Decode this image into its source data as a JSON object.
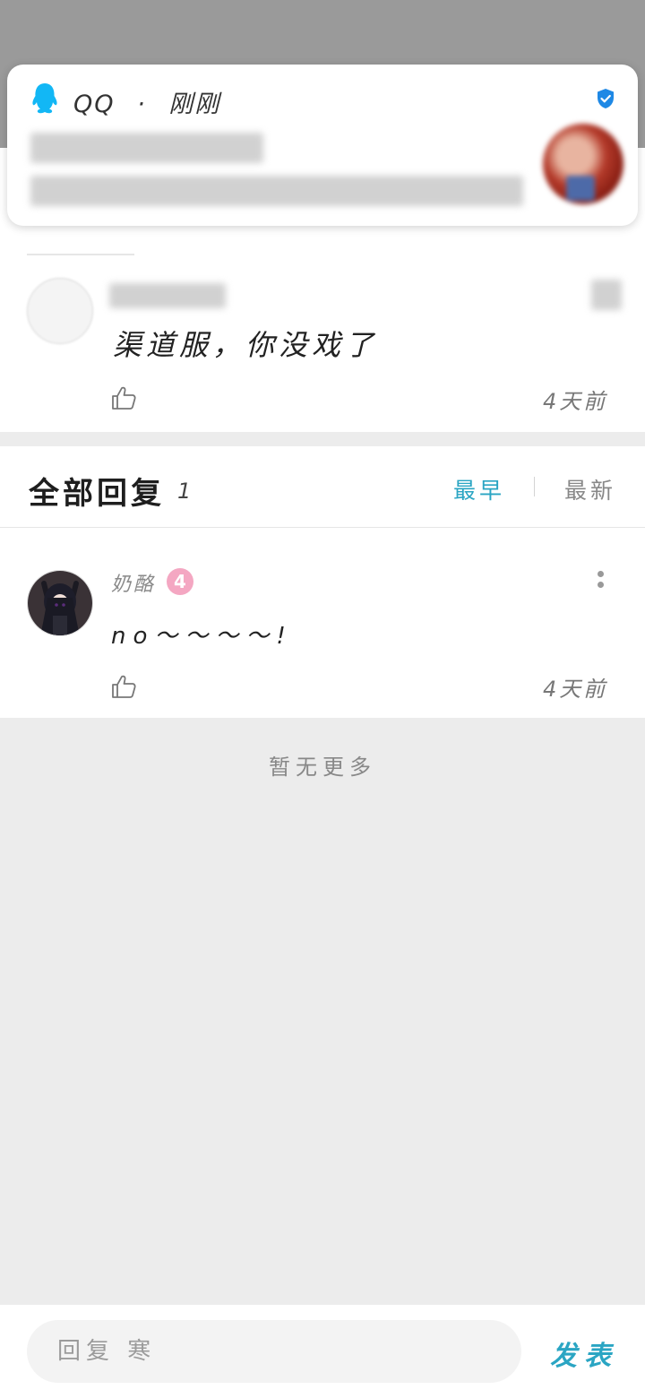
{
  "notification": {
    "app": "QQ",
    "separator": "·",
    "time": "刚刚"
  },
  "previous_comment": {
    "text": "渠道服，你没戏了",
    "time": "4天前"
  },
  "replies_header": {
    "title": "全部回复",
    "count": "1",
    "sort_earliest": "最早",
    "sort_newest": "最新",
    "active_sort": "最早"
  },
  "replies": [
    {
      "username": "奶酪",
      "level": "4",
      "text": "no～～～～!",
      "time": "4天前"
    }
  ],
  "footer_note": "暂无更多",
  "composer": {
    "placeholder": "回复 寒",
    "send_label": "发表"
  },
  "colors": {
    "accent": "#2aa5c3",
    "level_badge": "#f4a7c2",
    "verified": "#1e88e5",
    "qq_blue": "#12b7f5"
  }
}
